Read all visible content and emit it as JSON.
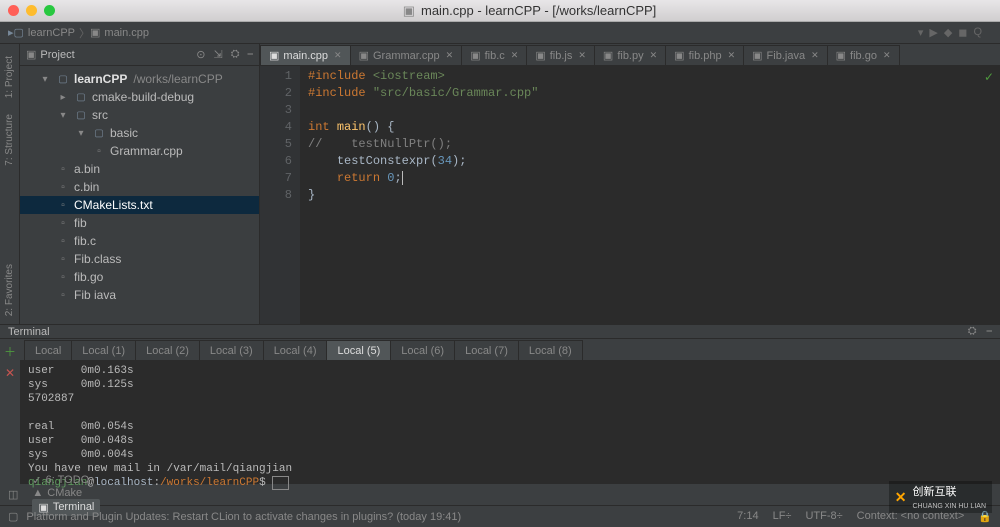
{
  "window_title": "main.cpp - learnCPP - [/works/learnCPP]",
  "breadcrumb": {
    "project": "learnCPP",
    "file": "main.cpp"
  },
  "tools_left": [
    "1: Project",
    "7: Structure",
    "2: Favorites"
  ],
  "project": {
    "header": "Project",
    "root": {
      "name": "learnCPP",
      "path": "/works/learnCPP"
    },
    "tree": [
      {
        "label": "cmake-build-debug",
        "indent": 2,
        "kind": "folder",
        "arrow": "▸"
      },
      {
        "label": "src",
        "indent": 2,
        "kind": "folder",
        "arrow": "▾"
      },
      {
        "label": "basic",
        "indent": 3,
        "kind": "folder",
        "arrow": "▾"
      },
      {
        "label": "Grammar.cpp",
        "indent": 4,
        "kind": "cpp"
      },
      {
        "label": "a.bin",
        "indent": 2,
        "kind": "file"
      },
      {
        "label": "c.bin",
        "indent": 2,
        "kind": "file"
      },
      {
        "label": "CMakeLists.txt",
        "indent": 2,
        "kind": "file",
        "selected": true,
        "fg": "#fff"
      },
      {
        "label": "fib",
        "indent": 2,
        "kind": "file"
      },
      {
        "label": "fib.c",
        "indent": 2,
        "kind": "file"
      },
      {
        "label": "Fib.class",
        "indent": 2,
        "kind": "file"
      },
      {
        "label": "fib.go",
        "indent": 2,
        "kind": "file"
      },
      {
        "label": "Fib iava",
        "indent": 2,
        "kind": "file"
      }
    ]
  },
  "tabs": [
    {
      "label": "main.cpp",
      "active": true,
      "icon": "cpp"
    },
    {
      "label": "Grammar.cpp",
      "icon": "cpp"
    },
    {
      "label": "fib.c",
      "icon": "c"
    },
    {
      "label": "fib.js",
      "icon": "js"
    },
    {
      "label": "fib.py",
      "icon": "py"
    },
    {
      "label": "fib.php",
      "icon": "php"
    },
    {
      "label": "Fib.java",
      "icon": "java"
    },
    {
      "label": "fib.go",
      "icon": "go"
    }
  ],
  "code": {
    "lines": [
      {
        "n": 1,
        "html": "<span class='c-keyword'>#include</span> <span class='c-string'>&lt;iostream&gt;</span>"
      },
      {
        "n": 2,
        "html": "<span class='c-keyword'>#include</span> <span class='c-string'>\"src/basic/Grammar.cpp\"</span>"
      },
      {
        "n": 3,
        "html": ""
      },
      {
        "n": 4,
        "html": "<span class='c-keyword'>int</span> <span class='c-func'>main</span><span class='bracket'>() {</span>"
      },
      {
        "n": 5,
        "html": "<span class='c-comment'>//    testNullPtr();</span>"
      },
      {
        "n": 6,
        "html": "    <span class='c-ident'>testConstexpr</span><span class='bracket'>(</span><span class='c-num'>34</span><span class='bracket'>);</span>"
      },
      {
        "n": 7,
        "html": "    <span class='c-keyword'>return</span> <span class='c-num'>0</span><span class='bracket'>;</span><span class='cursor'></span>"
      },
      {
        "n": 8,
        "html": "<span class='bracket'>}</span>"
      }
    ]
  },
  "terminal": {
    "title": "Terminal",
    "tabs": [
      "Local",
      "Local (1)",
      "Local (2)",
      "Local (3)",
      "Local (4)",
      "Local (5)",
      "Local (6)",
      "Local (7)",
      "Local (8)"
    ],
    "active_tab": 5,
    "lines": [
      "user    0m0.163s",
      "sys     0m0.125s",
      "5702887",
      "",
      "real    0m0.054s",
      "user    0m0.048s",
      "sys     0m0.004s",
      "You have new mail in /var/mail/qiangjian"
    ],
    "prompt": {
      "user": "qiangjian",
      "host": "localhost",
      "path": "/works/learnCPP",
      "symbol": "$"
    }
  },
  "bottom_nav": [
    {
      "label": "6: TODO",
      "icon": "✓"
    },
    {
      "label": "CMake",
      "icon": "▲"
    },
    {
      "label": "Terminal",
      "icon": "▣",
      "active": true
    }
  ],
  "status": {
    "left": "Platform and Plugin Updates: Restart CLion to activate changes in plugins? (today 19:41)",
    "pos": "7:14",
    "line_sep": "LF÷",
    "enc": "UTF-8÷",
    "ctx": "Context: <no context>",
    "lock": "🔒"
  },
  "watermark": {
    "text": "创新互联",
    "sub": "CHUANG XIN HU LIAN"
  }
}
